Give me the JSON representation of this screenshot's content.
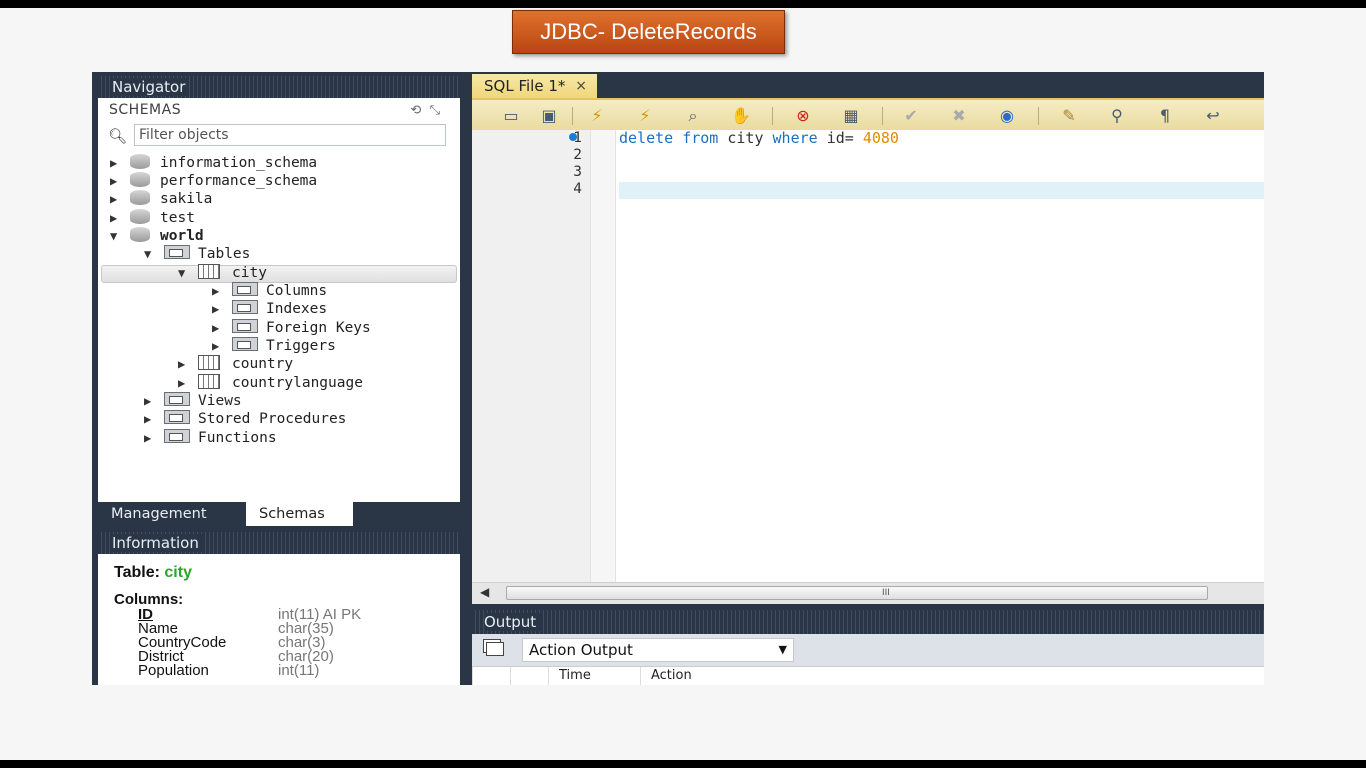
{
  "banner": {
    "title": "JDBC- DeleteRecords"
  },
  "navigator": {
    "header": "Navigator",
    "schemas_label": "SCHEMAS",
    "filter_placeholder": "Filter objects",
    "tree": [
      {
        "label": "information_schema",
        "type": "database",
        "state": "collapsed",
        "level": 0
      },
      {
        "label": "performance_schema",
        "type": "database",
        "state": "collapsed",
        "level": 0
      },
      {
        "label": "sakila",
        "type": "database",
        "state": "collapsed",
        "level": 0
      },
      {
        "label": "test",
        "type": "database",
        "state": "collapsed",
        "level": 0
      },
      {
        "label": "world",
        "type": "database",
        "state": "expanded",
        "level": 0,
        "bold": true
      },
      {
        "label": "Tables",
        "type": "folder",
        "state": "expanded",
        "level": 1
      },
      {
        "label": "city",
        "type": "table",
        "state": "expanded",
        "level": 2,
        "selected": true
      },
      {
        "label": "Columns",
        "type": "folder",
        "state": "collapsed",
        "level": 3
      },
      {
        "label": "Indexes",
        "type": "folder",
        "state": "collapsed",
        "level": 3
      },
      {
        "label": "Foreign Keys",
        "type": "folder",
        "state": "collapsed",
        "level": 3
      },
      {
        "label": "Triggers",
        "type": "folder",
        "state": "collapsed",
        "level": 3
      },
      {
        "label": "country",
        "type": "table",
        "state": "collapsed",
        "level": 2
      },
      {
        "label": "countrylanguage",
        "type": "table",
        "state": "collapsed",
        "level": 2
      },
      {
        "label": "Views",
        "type": "folder",
        "state": "collapsed",
        "level": 1
      },
      {
        "label": "Stored Procedures",
        "type": "folder",
        "state": "collapsed",
        "level": 1
      },
      {
        "label": "Functions",
        "type": "folder",
        "state": "collapsed",
        "level": 1
      }
    ],
    "tabs": {
      "management": "Management",
      "schemas": "Schemas"
    }
  },
  "information": {
    "header": "Information",
    "table_label": "Table:",
    "table_name": "city",
    "columns_label": "Columns:",
    "columns": [
      {
        "name": "ID",
        "type": "int(11) AI PK",
        "primary_key": true
      },
      {
        "name": "Name",
        "type": "char(35)"
      },
      {
        "name": "CountryCode",
        "type": "char(3)"
      },
      {
        "name": "District",
        "type": "char(20)"
      },
      {
        "name": "Population",
        "type": "int(11)"
      }
    ]
  },
  "editor": {
    "tab_label": "SQL File 1*",
    "tab_close": "×",
    "toolbar_icons": [
      "open-folder-icon",
      "save-icon",
      "execute-icon",
      "execute-selection-icon",
      "explain-icon",
      "stop-icon",
      "toggle-error-icon",
      "result-grid-icon",
      "commit-icon",
      "rollback-icon",
      "autocommit-icon",
      "beautify-icon",
      "find-icon",
      "invisible-chars-icon",
      "wrap-icon"
    ],
    "line_numbers": [
      "1",
      "2",
      "3",
      "4"
    ],
    "code": {
      "kw1": "delete",
      "kw2": "from",
      "ident1": "city",
      "kw3": "where",
      "ident2": "id=",
      "number": "4080"
    },
    "scroll_grip": "III"
  },
  "output": {
    "header": "Output",
    "selected_output": "Action Output",
    "columns": [
      "Time",
      "Action"
    ]
  },
  "colors": {
    "app_bg": "#2a3545",
    "banner": "#c9561c",
    "keyword": "#1a70c6",
    "number": "#e08a00",
    "table_name": "#2aa52a"
  }
}
